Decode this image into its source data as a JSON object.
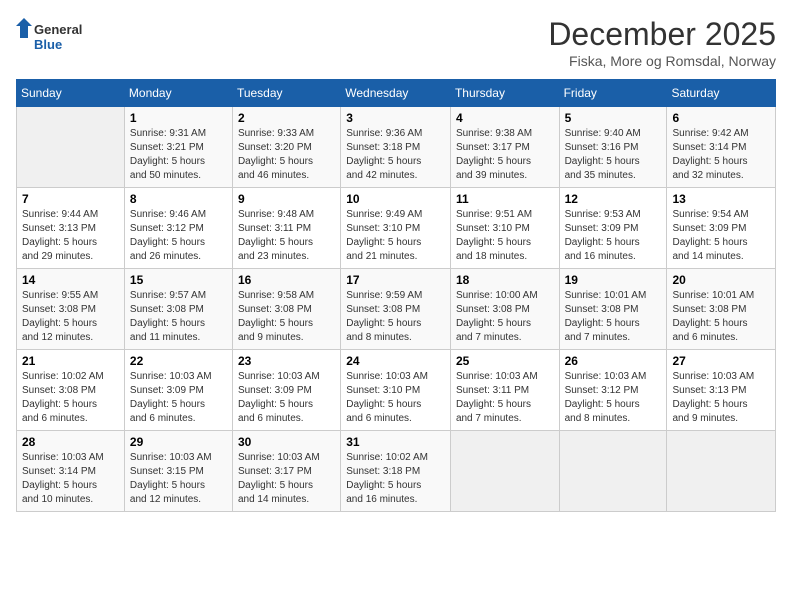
{
  "logo": {
    "line1": "General",
    "line2": "Blue"
  },
  "title": "December 2025",
  "location": "Fiska, More og Romsdal, Norway",
  "days_header": [
    "Sunday",
    "Monday",
    "Tuesday",
    "Wednesday",
    "Thursday",
    "Friday",
    "Saturday"
  ],
  "weeks": [
    [
      {
        "num": "",
        "info": ""
      },
      {
        "num": "1",
        "info": "Sunrise: 9:31 AM\nSunset: 3:21 PM\nDaylight: 5 hours\nand 50 minutes."
      },
      {
        "num": "2",
        "info": "Sunrise: 9:33 AM\nSunset: 3:20 PM\nDaylight: 5 hours\nand 46 minutes."
      },
      {
        "num": "3",
        "info": "Sunrise: 9:36 AM\nSunset: 3:18 PM\nDaylight: 5 hours\nand 42 minutes."
      },
      {
        "num": "4",
        "info": "Sunrise: 9:38 AM\nSunset: 3:17 PM\nDaylight: 5 hours\nand 39 minutes."
      },
      {
        "num": "5",
        "info": "Sunrise: 9:40 AM\nSunset: 3:16 PM\nDaylight: 5 hours\nand 35 minutes."
      },
      {
        "num": "6",
        "info": "Sunrise: 9:42 AM\nSunset: 3:14 PM\nDaylight: 5 hours\nand 32 minutes."
      }
    ],
    [
      {
        "num": "7",
        "info": "Sunrise: 9:44 AM\nSunset: 3:13 PM\nDaylight: 5 hours\nand 29 minutes."
      },
      {
        "num": "8",
        "info": "Sunrise: 9:46 AM\nSunset: 3:12 PM\nDaylight: 5 hours\nand 26 minutes."
      },
      {
        "num": "9",
        "info": "Sunrise: 9:48 AM\nSunset: 3:11 PM\nDaylight: 5 hours\nand 23 minutes."
      },
      {
        "num": "10",
        "info": "Sunrise: 9:49 AM\nSunset: 3:10 PM\nDaylight: 5 hours\nand 21 minutes."
      },
      {
        "num": "11",
        "info": "Sunrise: 9:51 AM\nSunset: 3:10 PM\nDaylight: 5 hours\nand 18 minutes."
      },
      {
        "num": "12",
        "info": "Sunrise: 9:53 AM\nSunset: 3:09 PM\nDaylight: 5 hours\nand 16 minutes."
      },
      {
        "num": "13",
        "info": "Sunrise: 9:54 AM\nSunset: 3:09 PM\nDaylight: 5 hours\nand 14 minutes."
      }
    ],
    [
      {
        "num": "14",
        "info": "Sunrise: 9:55 AM\nSunset: 3:08 PM\nDaylight: 5 hours\nand 12 minutes."
      },
      {
        "num": "15",
        "info": "Sunrise: 9:57 AM\nSunset: 3:08 PM\nDaylight: 5 hours\nand 11 minutes."
      },
      {
        "num": "16",
        "info": "Sunrise: 9:58 AM\nSunset: 3:08 PM\nDaylight: 5 hours\nand 9 minutes."
      },
      {
        "num": "17",
        "info": "Sunrise: 9:59 AM\nSunset: 3:08 PM\nDaylight: 5 hours\nand 8 minutes."
      },
      {
        "num": "18",
        "info": "Sunrise: 10:00 AM\nSunset: 3:08 PM\nDaylight: 5 hours\nand 7 minutes."
      },
      {
        "num": "19",
        "info": "Sunrise: 10:01 AM\nSunset: 3:08 PM\nDaylight: 5 hours\nand 7 minutes."
      },
      {
        "num": "20",
        "info": "Sunrise: 10:01 AM\nSunset: 3:08 PM\nDaylight: 5 hours\nand 6 minutes."
      }
    ],
    [
      {
        "num": "21",
        "info": "Sunrise: 10:02 AM\nSunset: 3:08 PM\nDaylight: 5 hours\nand 6 minutes."
      },
      {
        "num": "22",
        "info": "Sunrise: 10:03 AM\nSunset: 3:09 PM\nDaylight: 5 hours\nand 6 minutes."
      },
      {
        "num": "23",
        "info": "Sunrise: 10:03 AM\nSunset: 3:09 PM\nDaylight: 5 hours\nand 6 minutes."
      },
      {
        "num": "24",
        "info": "Sunrise: 10:03 AM\nSunset: 3:10 PM\nDaylight: 5 hours\nand 6 minutes."
      },
      {
        "num": "25",
        "info": "Sunrise: 10:03 AM\nSunset: 3:11 PM\nDaylight: 5 hours\nand 7 minutes."
      },
      {
        "num": "26",
        "info": "Sunrise: 10:03 AM\nSunset: 3:12 PM\nDaylight: 5 hours\nand 8 minutes."
      },
      {
        "num": "27",
        "info": "Sunrise: 10:03 AM\nSunset: 3:13 PM\nDaylight: 5 hours\nand 9 minutes."
      }
    ],
    [
      {
        "num": "28",
        "info": "Sunrise: 10:03 AM\nSunset: 3:14 PM\nDaylight: 5 hours\nand 10 minutes."
      },
      {
        "num": "29",
        "info": "Sunrise: 10:03 AM\nSunset: 3:15 PM\nDaylight: 5 hours\nand 12 minutes."
      },
      {
        "num": "30",
        "info": "Sunrise: 10:03 AM\nSunset: 3:17 PM\nDaylight: 5 hours\nand 14 minutes."
      },
      {
        "num": "31",
        "info": "Sunrise: 10:02 AM\nSunset: 3:18 PM\nDaylight: 5 hours\nand 16 minutes."
      },
      {
        "num": "",
        "info": ""
      },
      {
        "num": "",
        "info": ""
      },
      {
        "num": "",
        "info": ""
      }
    ]
  ]
}
